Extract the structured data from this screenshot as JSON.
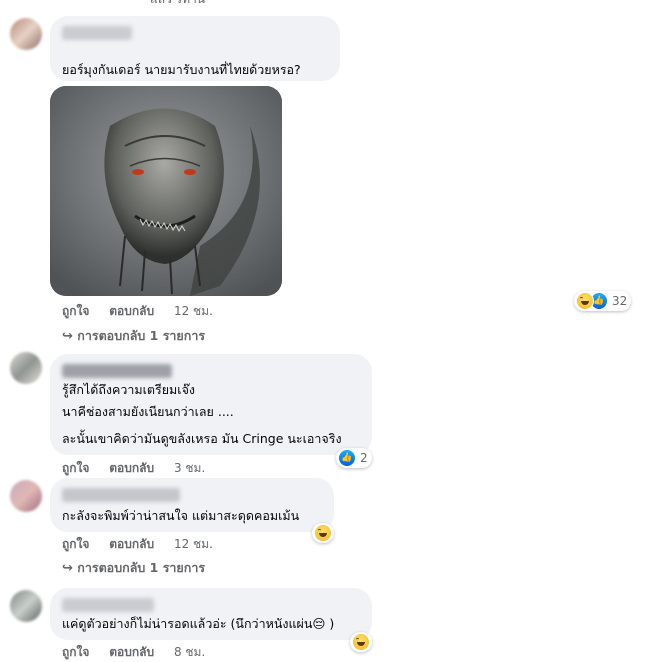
{
  "top_fragment": "แลว รทาน",
  "comments": [
    {
      "text_lines": [
        "ยอร์มุงกันเดอร์ นายมารับงานที่ไทยด้วยหรอ?"
      ],
      "actions": {
        "like": "ถูกใจ",
        "reply": "ตอบกลับ",
        "time": "12 ชม."
      },
      "reaction_count": "32",
      "replies_link": "การตอบกลับ 1 รายการ"
    },
    {
      "text_lines": [
        "รู้สึกได้ถึงความเตรียมเจ๊ง",
        "นาคีช่องสามยังเนียนกว่าเลย ....",
        "ละนั้นเขาคิดว่ามันดูขลังเหรอ มัน Cringe นะเอาจริง"
      ],
      "actions": {
        "like": "ถูกใจ",
        "reply": "ตอบกลับ",
        "time": "3 ชม."
      },
      "reaction_count": "2"
    },
    {
      "text_lines": [
        "กะลังจะพิมพ์ว่าน่าสนใจ แต่มาสะดุดคอมเม้น"
      ],
      "actions": {
        "like": "ถูกใจ",
        "reply": "ตอบกลับ",
        "time": "12 ชม."
      },
      "replies_link": "การตอบกลับ 1 รายการ"
    },
    {
      "text_lines": [
        "แค่ดูตัวอย่างก็ไม่น่ารอดแล้วอ่ะ (นึกว่าหนังแผ่น😔 )"
      ],
      "actions": {
        "like": "ถูกใจ",
        "reply": "ตอบกลับ",
        "time": "8 ชม."
      }
    }
  ],
  "icons": {
    "reply_arrow": "reply-arrow-icon",
    "haha": "haha-reaction-icon",
    "like": "like-reaction-icon"
  },
  "colors": {
    "bubble": "#f0f2f5",
    "meta": "#65676b",
    "like_blue": "#1877f2",
    "haha_yellow": "#f7b125"
  }
}
